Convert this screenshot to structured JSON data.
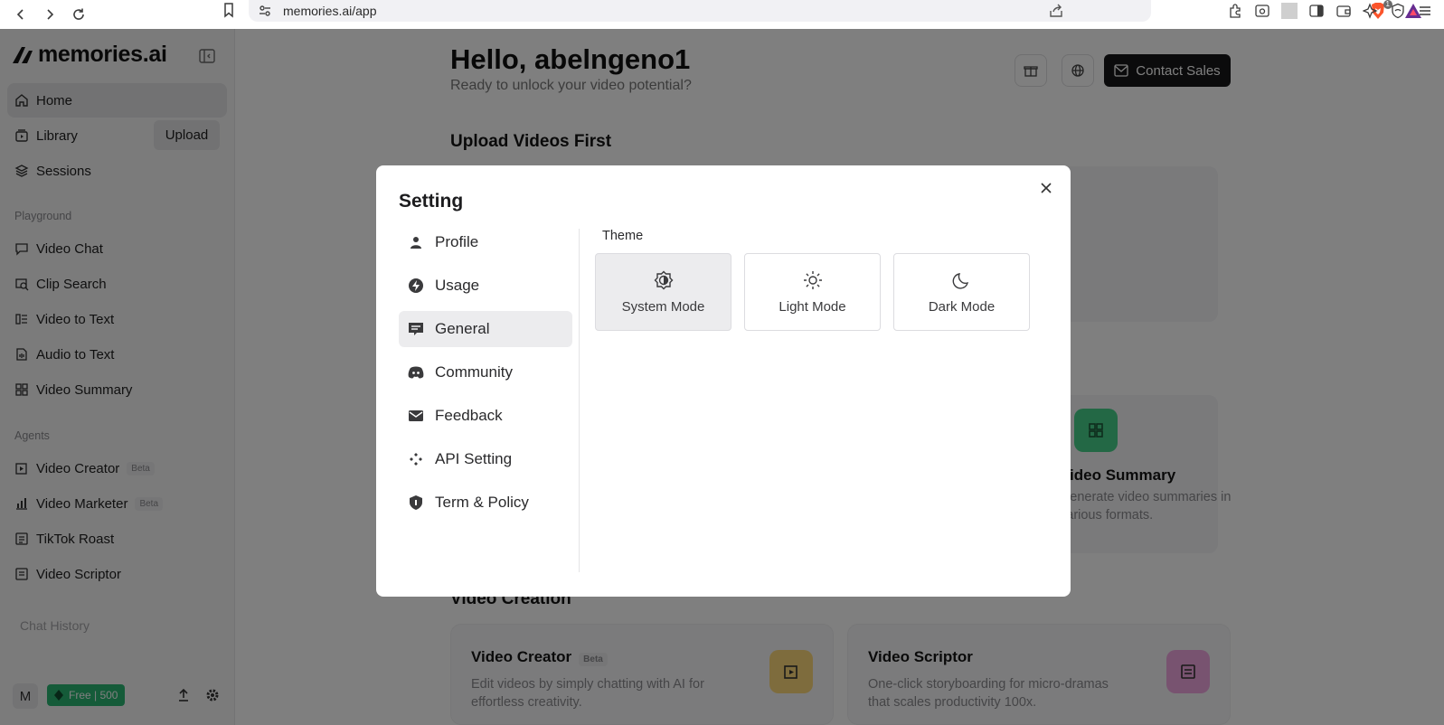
{
  "browser": {
    "url": "memories.ai/app",
    "extension_badge": "1"
  },
  "sidebar": {
    "logo": "memories.ai",
    "items": [
      {
        "label": "Home",
        "icon": "home-icon"
      },
      {
        "label": "Library",
        "icon": "library-icon"
      },
      {
        "label": "Sessions",
        "icon": "sessions-icon"
      }
    ],
    "upload_label": "Upload",
    "playground_label": "Playground",
    "playground": [
      {
        "label": "Video Chat"
      },
      {
        "label": "Clip Search"
      },
      {
        "label": "Video to Text"
      },
      {
        "label": "Audio to Text"
      },
      {
        "label": "Video Summary"
      }
    ],
    "agents_label": "Agents",
    "agents": [
      {
        "label": "Video Creator",
        "badge": "Beta"
      },
      {
        "label": "Video Marketer",
        "badge": "Beta"
      },
      {
        "label": "TikTok Roast"
      },
      {
        "label": "Video Scriptor"
      }
    ],
    "chat_history": "Chat History",
    "avatar": "M",
    "plan": "Free | 500"
  },
  "main": {
    "greeting": "Hello, abelngeno1",
    "subtitle": "Ready to unlock your video potential?",
    "contact_sales": "Contact Sales",
    "upload_heading": "Upload Videos First",
    "video_summary": {
      "title": "Video Summary",
      "desc": "Generate video summaries in various formats."
    },
    "creation_heading": "Video Creation",
    "cards": [
      {
        "title": "Video Creator",
        "badge": "Beta",
        "desc": "Edit videos by simply chatting with AI for effortless creativity."
      },
      {
        "title": "Video Scriptor",
        "desc": "One-click storyboarding for micro-dramas that scales productivity 100x."
      }
    ]
  },
  "modal": {
    "title": "Setting",
    "menu": [
      {
        "label": "Profile",
        "icon": "person-icon"
      },
      {
        "label": "Usage",
        "icon": "bolt-icon"
      },
      {
        "label": "General",
        "icon": "general-icon",
        "active": true
      },
      {
        "label": "Community",
        "icon": "discord-icon"
      },
      {
        "label": "Feedback",
        "icon": "mail-icon"
      },
      {
        "label": "API Setting",
        "icon": "api-icon"
      },
      {
        "label": "Term & Policy",
        "icon": "shield-icon"
      }
    ],
    "theme_label": "Theme",
    "theme_options": [
      {
        "label": "System Mode",
        "icon": "system-mode-icon",
        "selected": true
      },
      {
        "label": "Light Mode",
        "icon": "sun-icon"
      },
      {
        "label": "Dark Mode",
        "icon": "moon-icon"
      }
    ]
  }
}
